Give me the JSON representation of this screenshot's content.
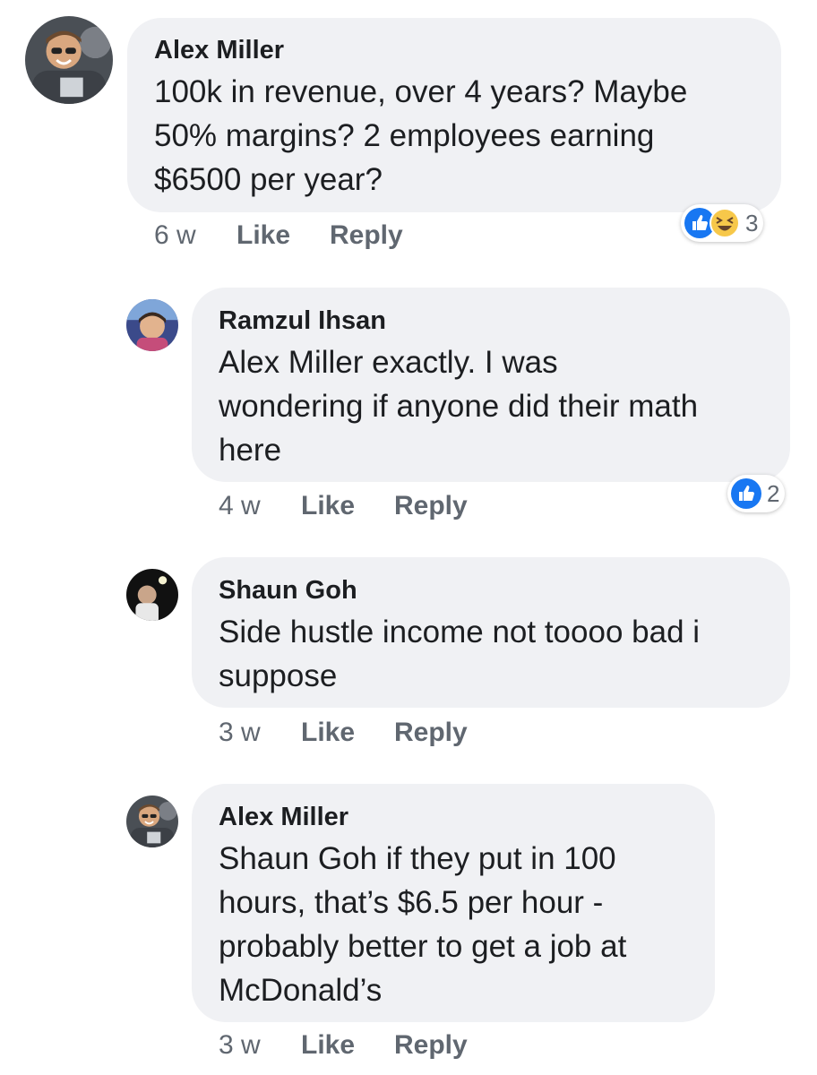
{
  "comments": [
    {
      "author": "Alex Miller",
      "lines": [
        "100k in revenue, over 4 years?  Maybe",
        "50% margins? 2 employees earning",
        "$6500 per year?"
      ],
      "time": "6 w",
      "like_label": "Like",
      "reply_label": "Reply",
      "reaction_count": "3",
      "reactions": [
        "like-icon",
        "haha-icon"
      ]
    },
    {
      "author": "Ramzul Ihsan",
      "lines": [
        "Alex Miller exactly. I was",
        "wondering if anyone did their math",
        "here"
      ],
      "time": "4 w",
      "like_label": "Like",
      "reply_label": "Reply",
      "reaction_count": "2",
      "reactions": [
        "like-icon"
      ]
    },
    {
      "author": "Shaun Goh",
      "lines": [
        "Side hustle income not toooo bad i",
        "suppose"
      ],
      "time": "3 w",
      "like_label": "Like",
      "reply_label": "Reply"
    },
    {
      "author": "Alex Miller",
      "lines": [
        "Shaun Goh if they put in 100",
        "hours, that’s $6.5 per hour -",
        "probably better to get a job at",
        "McDonald’s"
      ],
      "time": "3 w",
      "like_label": "Like",
      "reply_label": "Reply"
    }
  ],
  "colors": {
    "bubble": "#f0f1f4",
    "meta_text": "#606770",
    "like_blue": "#1877f2",
    "haha_yellow": "#f7c84a"
  }
}
